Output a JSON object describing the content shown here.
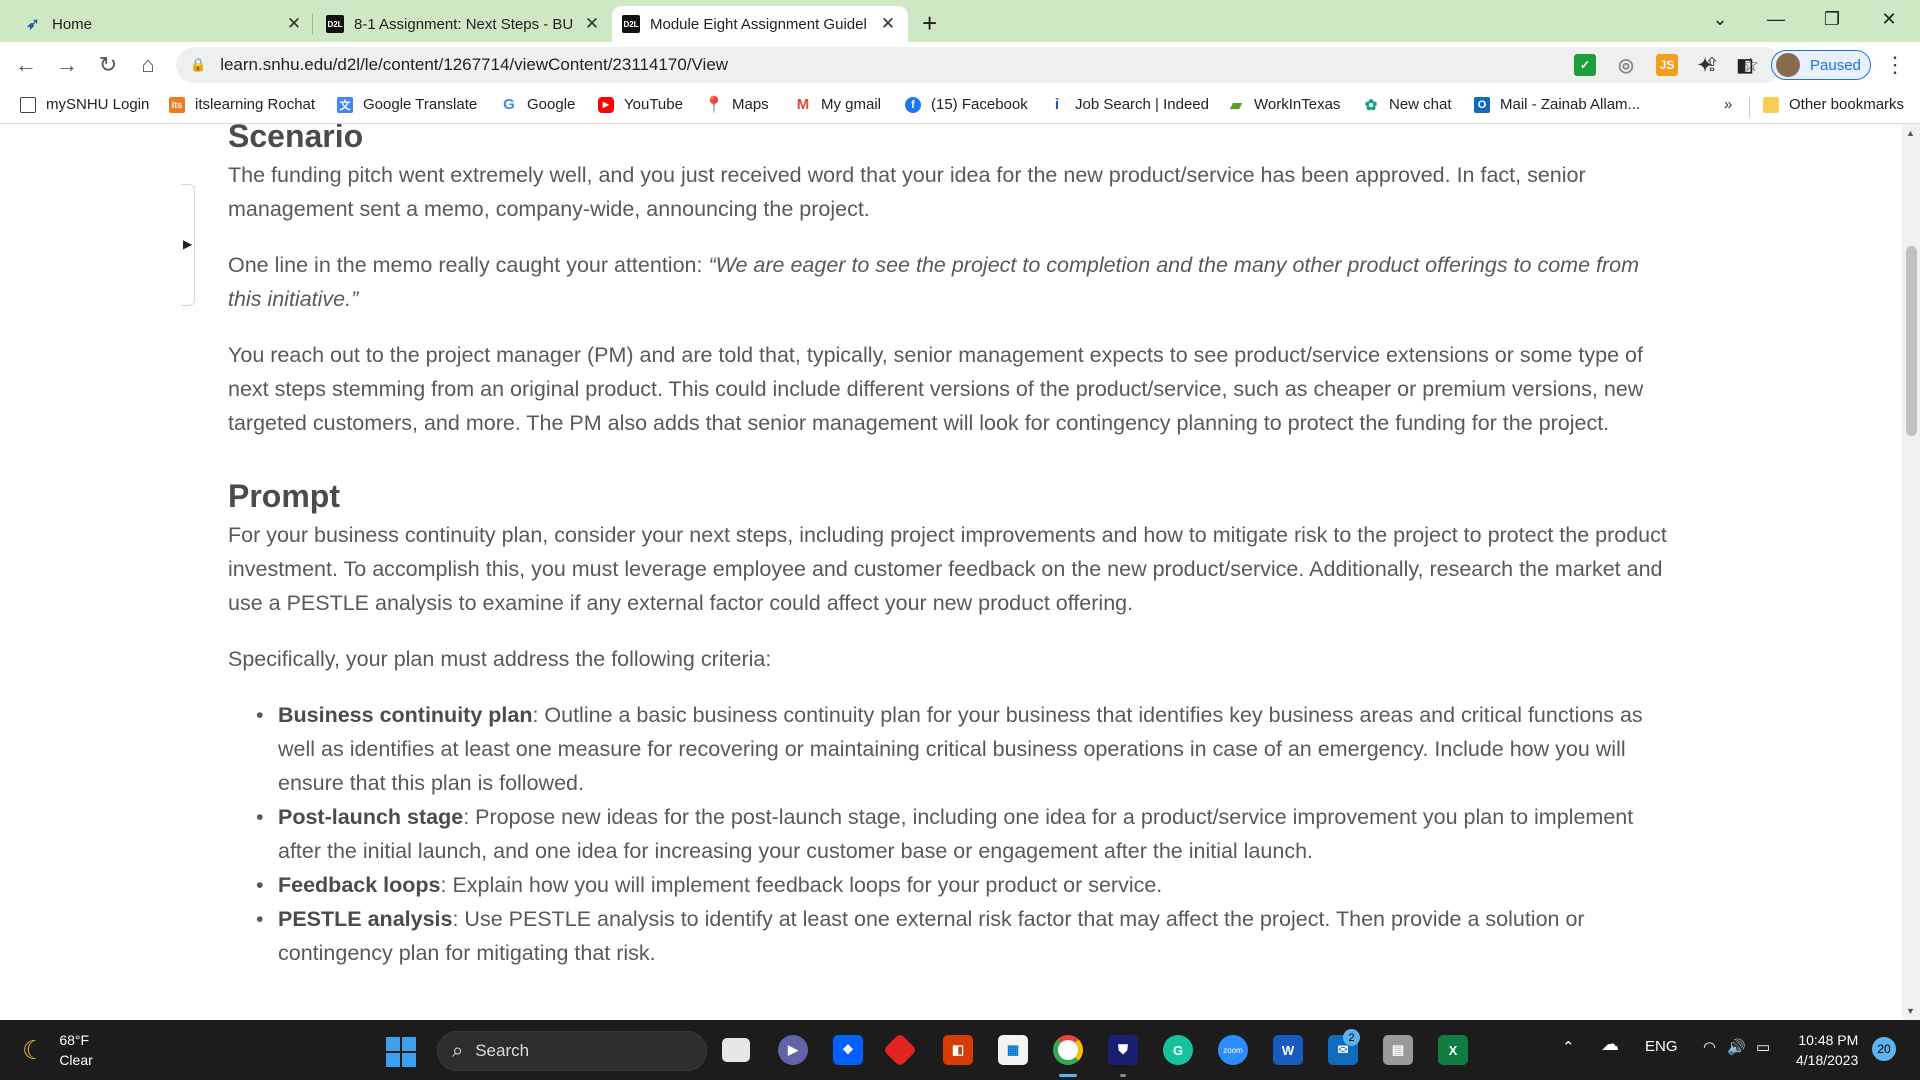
{
  "tabs": [
    {
      "title": "Home",
      "icon": "home-feather-icon",
      "active": false
    },
    {
      "title": "8-1 Assignment: Next Steps - BU",
      "icon": "d2l-icon",
      "active": false
    },
    {
      "title": "Module Eight Assignment Guidel",
      "icon": "d2l-icon",
      "active": true
    }
  ],
  "favicon_d2l": "D2L",
  "toolbar": {
    "url": "learn.snhu.edu/d2l/le/content/1267714/viewContent/23114170/View",
    "profile_label": "Paused",
    "ext_js": "JS"
  },
  "bookmarks": [
    {
      "label": "mySNHU Login"
    },
    {
      "label": "itslearning Rochat",
      "icon_text": "its"
    },
    {
      "label": "Google Translate"
    },
    {
      "label": "Google",
      "icon_text": "G"
    },
    {
      "label": "YouTube"
    },
    {
      "label": "Maps"
    },
    {
      "label": "My gmail",
      "icon_text": "M"
    },
    {
      "label": "(15) Facebook",
      "icon_text": "f"
    },
    {
      "label": "Job Search | Indeed"
    },
    {
      "label": "WorkInTexas"
    },
    {
      "label": "New chat"
    },
    {
      "label": "Mail - Zainab Allam..."
    },
    {
      "label": "Other bookmarks"
    }
  ],
  "bookmarks_more": "»",
  "doc": {
    "scenario_heading": "Scenario",
    "scenario_p1": "The funding pitch went extremely well, and you just received word that your idea for the new product/service has been approved. In fact, senior management sent a memo, company-wide, announcing the project.",
    "scenario_p2_lead": "One line in the memo really caught your attention: ",
    "scenario_p2_quote": "“We are eager to see the project to completion and the many other product offerings to come from this initiative.”",
    "scenario_p3": "You reach out to the project manager (PM) and are told that, typically, senior management expects to see product/service extensions or some type of next steps stemming from an original product. This could include different versions of the product/service, such as cheaper or premium versions, new targeted customers, and more. The PM also adds that senior management will look for contingency planning to protect the funding for the project.",
    "prompt_heading": "Prompt",
    "prompt_p1": "For your business continuity plan, consider your next steps, including project improvements and how to mitigate risk to the project to protect the product investment. To accomplish this, you must leverage employee and customer feedback on the new product/service. Additionally, research the market and use a PESTLE analysis to examine if any external factor could affect your new product offering.",
    "prompt_p2": "Specifically, your plan must address the following criteria:",
    "criteria": [
      {
        "term": "Business continuity plan",
        "text": ": Outline a basic business continuity plan for your business that identifies key business areas and critical functions as well as identifies at least one measure for recovering or maintaining critical business operations in case of an emergency. Include how you will ensure that this plan is followed."
      },
      {
        "term": "Post-launch stage",
        "text": ": Propose new ideas for the post-launch stage, including one idea for a product/service improvement you plan to implement after the initial launch, and one idea for increasing your customer base or engagement after the initial launch."
      },
      {
        "term": "Feedback loops",
        "text": ": Explain how you will implement feedback loops for your product or service."
      },
      {
        "term": "PESTLE analysis",
        "text": ": Use PESTLE analysis to identify at least one external risk factor that may affect the project. Then provide a solution or contingency plan for mitigating that risk."
      }
    ]
  },
  "taskbar": {
    "temperature": "68°F",
    "condition": "Clear",
    "search_label": "Search",
    "zoom_label": "zoom",
    "word_label": "W",
    "excel_label": "X",
    "mail_badge": "2",
    "lang": "ENG",
    "time": "10:48 PM",
    "date": "4/18/2023",
    "notifications": "20"
  }
}
